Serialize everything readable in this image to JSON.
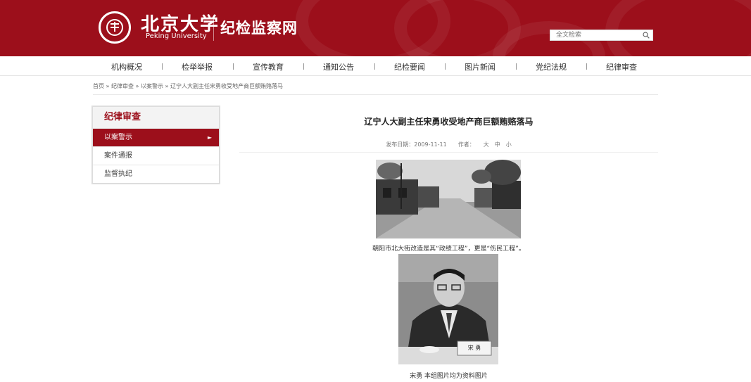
{
  "header": {
    "logo_cn": "北京大学",
    "logo_en": "Peking University",
    "site_title": "纪检监察网",
    "search_placeholder": "全文检索",
    "search_icon": "search-icon"
  },
  "nav": {
    "items": [
      "机构概况",
      "检举举报",
      "宣传教育",
      "通知公告",
      "纪检要闻",
      "图片新闻",
      "党纪法规",
      "纪律审查"
    ]
  },
  "breadcrumb": {
    "text": "首页 » 纪律审查 » 以案警示 » 辽宁人大副主任宋勇收受地产商巨额贿赂落马"
  },
  "sidebar": {
    "title": "纪律审查",
    "items": [
      {
        "label": "以案警示",
        "arrow": "►"
      },
      {
        "label": "案件通报"
      },
      {
        "label": "监督执纪"
      }
    ]
  },
  "article": {
    "title": "辽宁人大副主任宋勇收受地产商巨额贿赂落马",
    "meta": "发布日期：2009-11-11　　作者：　　大　中　小",
    "caption1": "朝阳市北大街改造是其“政绩工程”，更是“伤民工程”。",
    "caption2": "宋勇 本组图片均为资料图片",
    "nameplate": "宋 勇"
  },
  "colors": {
    "brand": "#9c0f1b",
    "nav_text": "#333333"
  }
}
